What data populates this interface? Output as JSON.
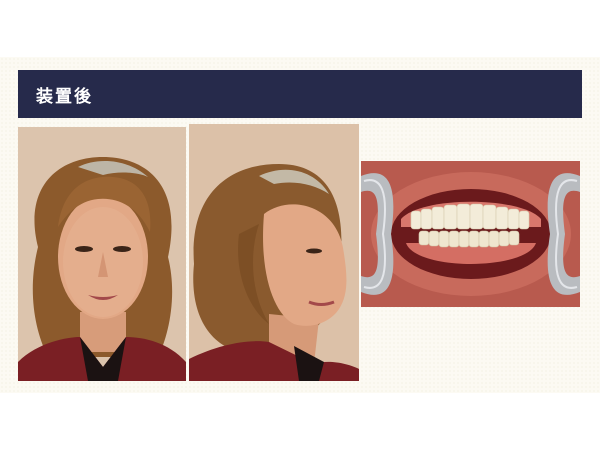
{
  "slide": {
    "title": "装置後",
    "colors": {
      "header_bg": "#262a4b",
      "header_text": "#ffffff",
      "slide_bg": "#fcfaf3"
    }
  },
  "photos": [
    {
      "id": "front",
      "subject": "frontal-face-photo"
    },
    {
      "id": "side",
      "subject": "oblique-face-photo"
    },
    {
      "id": "intra",
      "subject": "intraoral-photo-with-cheek-retractor"
    }
  ]
}
